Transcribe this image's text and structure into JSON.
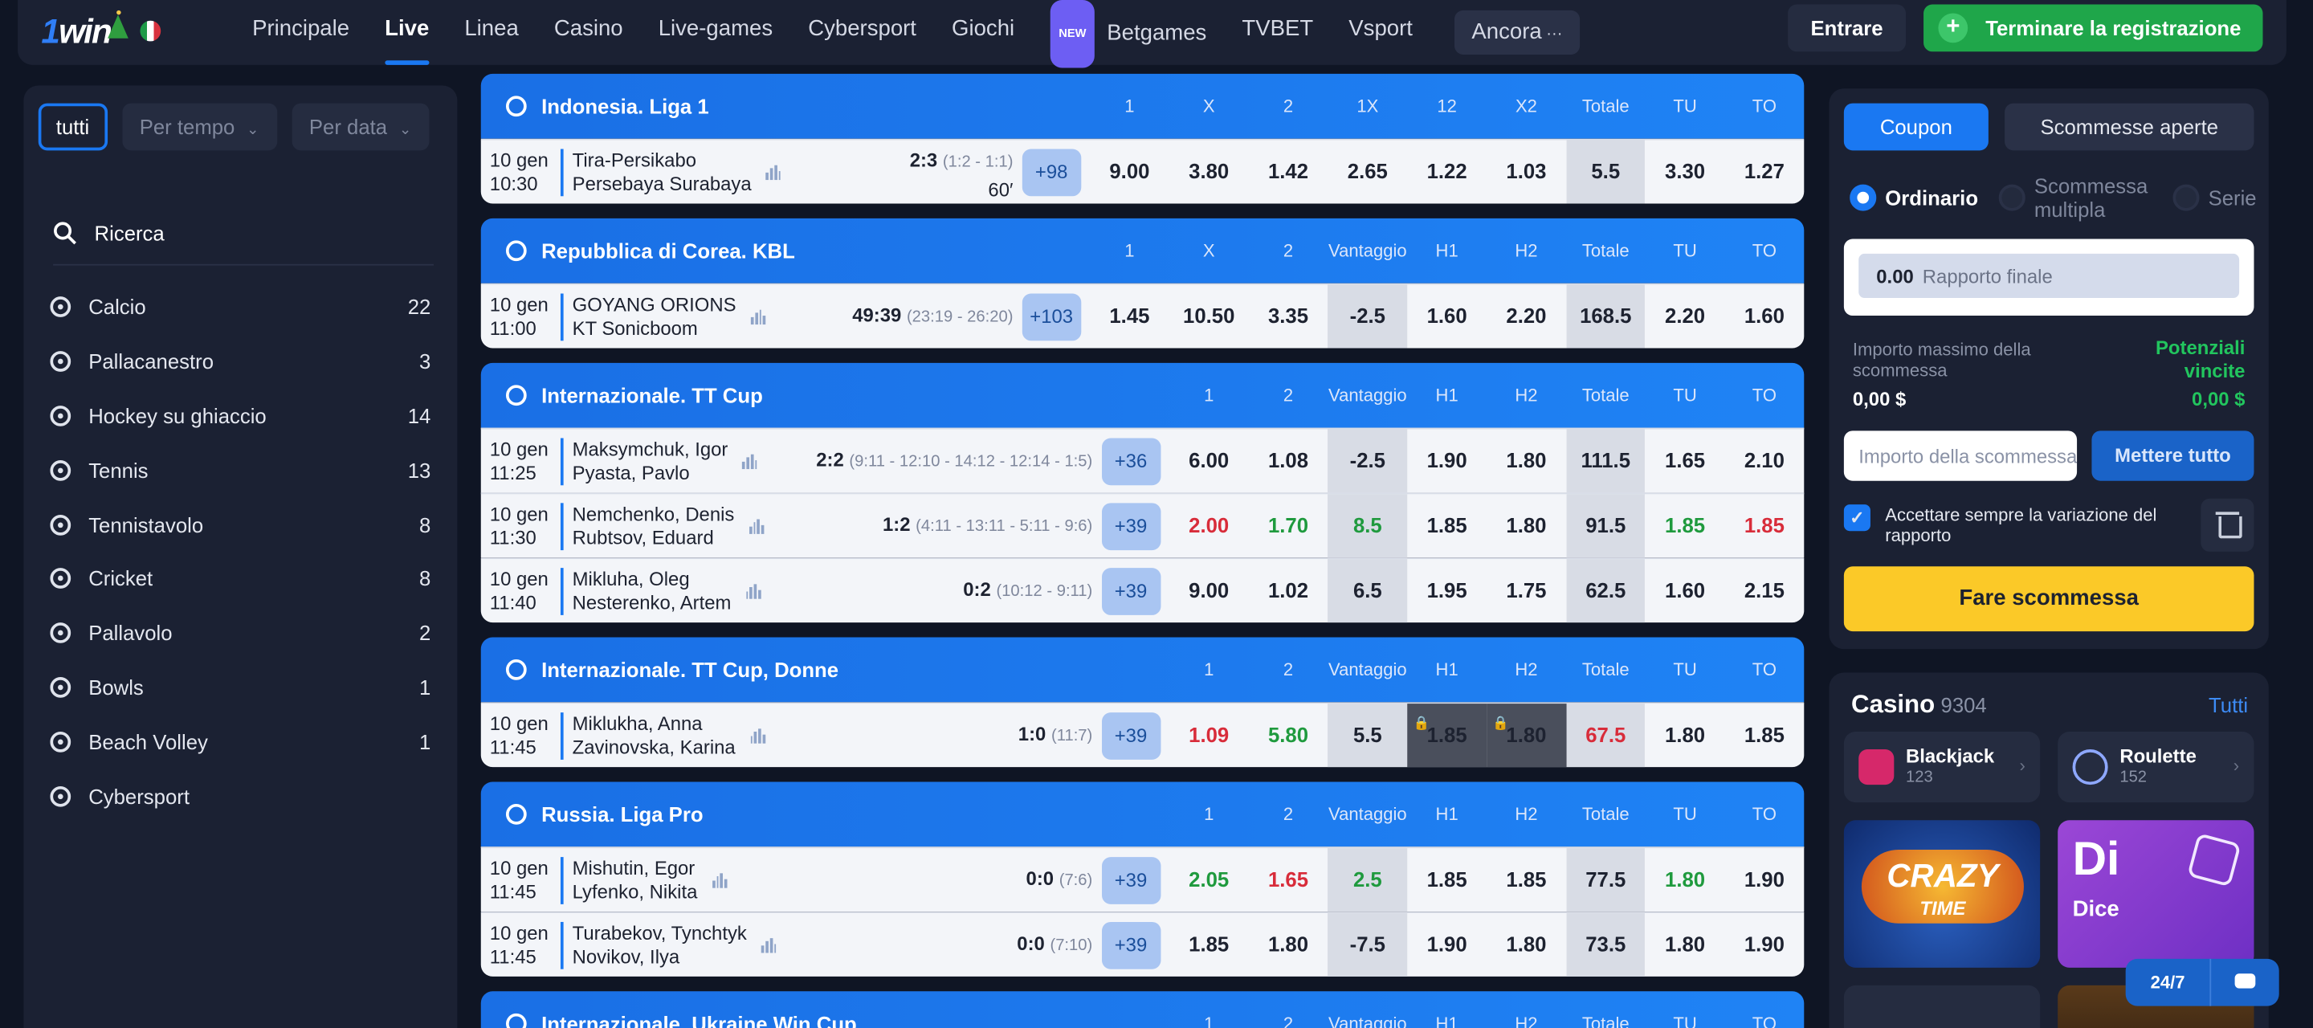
{
  "header": {
    "logo": {
      "one": "1",
      "win": "win"
    },
    "nav": [
      "Principale",
      "Live",
      "Linea",
      "Casino",
      "Live-games",
      "Cybersport",
      "Giochi"
    ],
    "active_nav": "Live",
    "new_badge": "NEW",
    "nav2": [
      "Betgames",
      "TVBET",
      "Vsport"
    ],
    "more": "Ancora",
    "login": "Entrare",
    "register": "Terminare la registrazione"
  },
  "sidebar": {
    "filters": {
      "all": "tutti",
      "time": "Per tempo",
      "date": "Per data"
    },
    "search": "Ricerca",
    "sports": [
      {
        "name": "Calcio",
        "count": "22"
      },
      {
        "name": "Pallacanestro",
        "count": "3"
      },
      {
        "name": "Hockey su ghiaccio",
        "count": "14"
      },
      {
        "name": "Tennis",
        "count": "13"
      },
      {
        "name": "Tennistavolo",
        "count": "8"
      },
      {
        "name": "Cricket",
        "count": "8"
      },
      {
        "name": "Pallavolo",
        "count": "2"
      },
      {
        "name": "Bowls",
        "count": "1"
      },
      {
        "name": "Beach Volley",
        "count": "1"
      },
      {
        "name": "Cybersport",
        "count": ""
      }
    ]
  },
  "leagues": [
    {
      "name": "Indonesia. Liga 1",
      "cols": [
        "1",
        "X",
        "2",
        "1X",
        "12",
        "X2",
        "Totale",
        "TU",
        "TO"
      ],
      "rows": [
        {
          "date": "10 gen",
          "time": "10:30",
          "home": "Tira-Persikabo",
          "away": "Persebaya Surabaya",
          "score": "2:3",
          "detail": "(1:2 - 1:1)",
          "minute": "60′",
          "more": "+98",
          "odds": [
            "9.00",
            "3.80",
            "1.42",
            "2.65",
            "1.22",
            "1.03",
            "5.5",
            "3.30",
            "1.27"
          ]
        }
      ]
    },
    {
      "name": "Repubblica di Corea. KBL",
      "cols": [
        "1",
        "X",
        "2",
        "Vantaggio",
        "H1",
        "H2",
        "Totale",
        "TU",
        "TO"
      ],
      "rows": [
        {
          "date": "10 gen",
          "time": "11:00",
          "home": "GOYANG ORIONS",
          "away": "KT Sonicboom",
          "score": "49:39",
          "detail": "(23:19 - 26:20)",
          "more": "+103",
          "odds": [
            "1.45",
            "10.50",
            "3.35",
            "-2.5",
            "1.60",
            "2.20",
            "168.5",
            "2.20",
            "1.60"
          ]
        }
      ]
    },
    {
      "name": "Internazionale. TT Cup",
      "cols": [
        "1",
        "2",
        "Vantaggio",
        "H1",
        "H2",
        "Totale",
        "TU",
        "TO"
      ],
      "rows": [
        {
          "date": "10 gen",
          "time": "11:25",
          "home": "Maksymchuk, Igor",
          "away": "Pyasta, Pavlo",
          "score": "2:2",
          "detail": "(9:11 - 12:10 - 14:12 - 12:14 - 1:5)",
          "more": "+36",
          "odds": [
            "6.00",
            "1.08",
            "-2.5",
            "1.90",
            "1.80",
            "111.5",
            "1.65",
            "2.10"
          ]
        },
        {
          "date": "10 gen",
          "time": "11:30",
          "home": "Nemchenko, Denis",
          "away": "Rubtsov, Eduard",
          "score": "1:2",
          "detail": "(4:11 - 13:11 - 5:11 - 9:6)",
          "more": "+39",
          "odds": [
            "2.00",
            "1.70",
            "8.5",
            "1.85",
            "1.80",
            "91.5",
            "1.85",
            "1.85"
          ]
        },
        {
          "date": "10 gen",
          "time": "11:40",
          "home": "Mikluha, Oleg",
          "away": "Nesterenko, Artem",
          "score": "0:2",
          "detail": "(10:12 - 9:11)",
          "more": "+39",
          "odds": [
            "9.00",
            "1.02",
            "6.5",
            "1.95",
            "1.75",
            "62.5",
            "1.60",
            "2.15"
          ]
        }
      ]
    },
    {
      "name": "Internazionale. TT Cup, Donne",
      "cols": [
        "1",
        "2",
        "Vantaggio",
        "H1",
        "H2",
        "Totale",
        "TU",
        "TO"
      ],
      "rows": [
        {
          "date": "10 gen",
          "time": "11:45",
          "home": "Miklukha, Anna",
          "away": "Zavinovska, Karina",
          "score": "1:0",
          "detail": "(11:7)",
          "more": "+39",
          "odds": [
            "1.09",
            "5.80",
            "5.5",
            "1.85",
            "1.80",
            "67.5",
            "1.80",
            "1.85"
          ]
        }
      ]
    },
    {
      "name": "Russia. Liga Pro",
      "cols": [
        "1",
        "2",
        "Vantaggio",
        "H1",
        "H2",
        "Totale",
        "TU",
        "TO"
      ],
      "rows": [
        {
          "date": "10 gen",
          "time": "11:45",
          "home": "Mishutin, Egor",
          "away": "Lyfenko, Nikita",
          "score": "0:0",
          "detail": "(7:6)",
          "more": "+39",
          "odds": [
            "2.05",
            "1.65",
            "2.5",
            "1.85",
            "1.85",
            "77.5",
            "1.80",
            "1.90"
          ]
        },
        {
          "date": "10 gen",
          "time": "11:45",
          "home": "Turabekov, Tynchtyk",
          "away": "Novikov, Ilya",
          "score": "0:0",
          "detail": "(7:10)",
          "more": "+39",
          "odds": [
            "1.85",
            "1.80",
            "-7.5",
            "1.90",
            "1.80",
            "73.5",
            "1.80",
            "1.90"
          ]
        }
      ]
    },
    {
      "name": "Internazionale. Ukraine Win Cup",
      "cols": [
        "1",
        "2",
        "Vantaggio",
        "H1",
        "H2",
        "Totale",
        "TU",
        "TO"
      ],
      "rows": []
    }
  ],
  "coupon": {
    "tab_coupon": "Coupon",
    "tab_open": "Scommesse aperte",
    "modes": [
      "Ordinario",
      "Scommessa multipla",
      "Serie"
    ],
    "ratio_value": "0.00",
    "ratio_label": "Rapporto finale",
    "max_label": "Importo massimo della scommessa",
    "max_value": "0,00 $",
    "win_label": "Potenziali vincite",
    "win_value": "0,00 $",
    "amount_placeholder": "Importo della scommessa",
    "all_in": "Mettere tutto",
    "accept": "Accettare sempre la variazione del rapporto",
    "place": "Fare scommessa"
  },
  "casino": {
    "title": "Casino",
    "count": "9304",
    "all": "Tutti",
    "games": [
      {
        "name": "Blackjack",
        "count": "123"
      },
      {
        "name": "Roulette",
        "count": "152"
      }
    ],
    "tiles": {
      "crazy_1": "CRAZY",
      "crazy_2": "TIME",
      "dice_big": "Di",
      "dice_label": "Dice"
    }
  },
  "support": {
    "label": "24/7"
  }
}
